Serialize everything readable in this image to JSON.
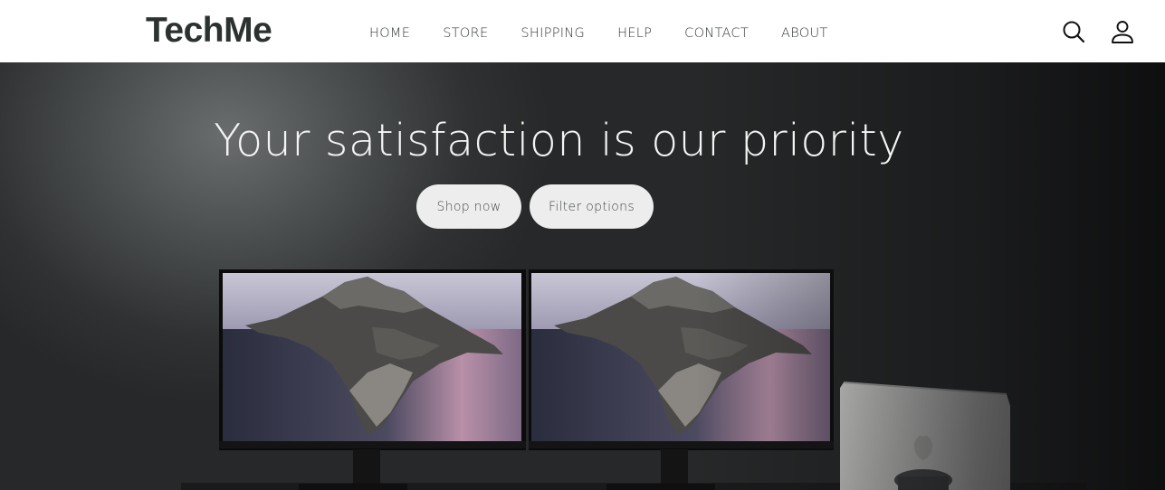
{
  "brand": {
    "name": "TechMe"
  },
  "nav": {
    "items": [
      {
        "label": "HOME"
      },
      {
        "label": "STORE"
      },
      {
        "label": "SHIPPING"
      },
      {
        "label": "HELP"
      },
      {
        "label": "CONTACT"
      },
      {
        "label": "ABOUT"
      }
    ]
  },
  "header_icons": {
    "search": "search-icon",
    "account": "user-icon"
  },
  "hero": {
    "title": "Your satisfaction is our priority",
    "primary_button": "Shop now",
    "secondary_button": "Filter options"
  },
  "colors": {
    "logo": "#2b322f",
    "nav_text": "#333a38",
    "button_bg": "#ededed",
    "hero_text": "#f4f4f4"
  }
}
